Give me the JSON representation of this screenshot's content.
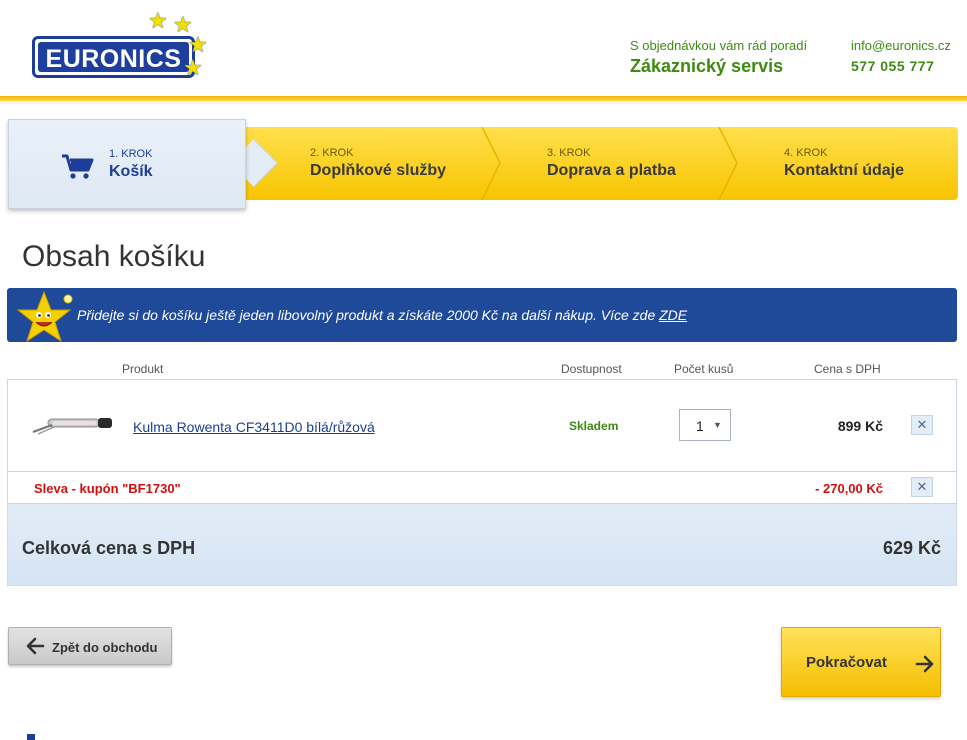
{
  "header": {
    "logo_text": "EURONICS",
    "service_sub": "S objednávkou vám rád poradí",
    "service_title": "Zákaznický servis",
    "email": "info@euronics.cz",
    "phone": "577 055 777"
  },
  "steps": [
    {
      "num": "1. KROK",
      "name": "Košík",
      "active": true,
      "icon": "cart-icon"
    },
    {
      "num": "2. KROK",
      "name": "Doplňkové služby",
      "active": false
    },
    {
      "num": "3. KROK",
      "name": "Doprava a platba",
      "active": false
    },
    {
      "num": "4. KROK",
      "name": "Kontaktní údaje",
      "active": false
    }
  ],
  "page_title": "Obsah košíku",
  "banner": {
    "text": "Přidejte si do košíku ještě jeden libovolný produkt a získáte 2000 Kč na další nákup. Více zde ",
    "link": "ZDE",
    "icon": "star-mascot-icon"
  },
  "table": {
    "headers": {
      "product": "Produkt",
      "availability": "Dostupnost",
      "quantity": "Počet kusů",
      "price": "Cena s DPH"
    },
    "items": [
      {
        "name": "Kulma Rowenta CF3411D0 bílá/růžová",
        "availability": "Skladem",
        "quantity": "1",
        "price": "899 Kč"
      }
    ],
    "coupon": {
      "label": "Sleva - kupón \"BF1730\"",
      "value": "- 270,00 Kč"
    }
  },
  "total": {
    "label": "Celková cena s DPH",
    "value": "629 Kč"
  },
  "buttons": {
    "back": "Zpět do obchodu",
    "next": "Pokračovat"
  },
  "colors": {
    "brand_blue": "#1d3d99",
    "accent_yellow": "#f7c400",
    "green": "#3f8a12",
    "red": "#d01010"
  }
}
